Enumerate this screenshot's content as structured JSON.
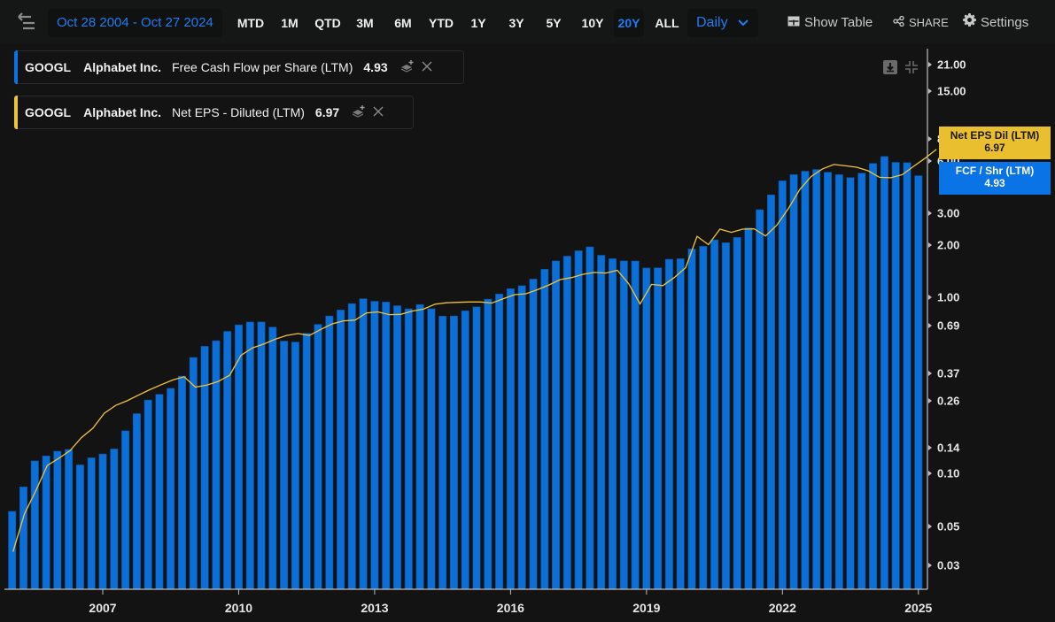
{
  "toolbar": {
    "date_range": "Oct 28 2004 - Oct 27 2024",
    "ranges": [
      "MTD",
      "1M",
      "QTD",
      "3M",
      "6M",
      "YTD",
      "1Y",
      "3Y",
      "5Y",
      "10Y",
      "20Y",
      "ALL"
    ],
    "active_range": "20Y",
    "interval": "Daily",
    "show_table_label": "Show Table",
    "share_label": "SHARE",
    "settings_label": "Settings"
  },
  "legend": [
    {
      "ticker": "GOOGL",
      "company": "Alphabet Inc.",
      "metric": "Free Cash Flow per Share (LTM)",
      "value": "4.93",
      "color": "#0a73e6"
    },
    {
      "ticker": "GOOGL",
      "company": "Alphabet Inc.",
      "metric": "Net EPS - Diluted (LTM)",
      "value": "6.97",
      "color": "#f0c43a"
    }
  ],
  "price_tags": {
    "eps": {
      "label": "Net EPS Dil (LTM)",
      "value": "6.97"
    },
    "fcf": {
      "label": "FCF / Shr (LTM)",
      "value": "4.93"
    }
  },
  "chart_data": {
    "type": "bar+line",
    "yscale": "log",
    "ylim": [
      0.022,
      26
    ],
    "xlim": [
      2004.83,
      2025.2
    ],
    "y_ticks": [
      "21.00",
      "15.00",
      "8.00",
      "6.00",
      "3.00",
      "2.00",
      "1.00",
      "0.69",
      "0.37",
      "0.26",
      "0.14",
      "0.10",
      "0.05",
      "0.03"
    ],
    "y_tick_values": [
      21,
      15,
      8,
      6,
      3,
      2,
      1,
      0.69,
      0.37,
      0.26,
      0.14,
      0.1,
      0.05,
      0.03
    ],
    "x_ticks": [
      "2007",
      "2010",
      "2013",
      "2016",
      "2019",
      "2022",
      "2025"
    ],
    "x_tick_values": [
      2007,
      2010,
      2013,
      2016,
      2019,
      2022,
      2025
    ],
    "x_start": 2005.0,
    "x_step": 0.25,
    "series": [
      {
        "name": "Free Cash Flow per Share (LTM)",
        "kind": "bar",
        "color": "#0a6fd8",
        "values": [
          0.061,
          0.084,
          0.118,
          0.126,
          0.134,
          0.137,
          0.112,
          0.123,
          0.129,
          0.138,
          0.175,
          0.219,
          0.262,
          0.282,
          0.305,
          0.358,
          0.457,
          0.529,
          0.568,
          0.643,
          0.7,
          0.727,
          0.727,
          0.68,
          0.566,
          0.559,
          0.627,
          0.705,
          0.787,
          0.85,
          0.924,
          0.986,
          0.953,
          0.944,
          0.9,
          0.864,
          0.913,
          0.865,
          0.785,
          0.786,
          0.841,
          0.886,
          0.98,
          1.048,
          1.124,
          1.169,
          1.275,
          1.45,
          1.617,
          1.72,
          1.846,
          1.943,
          1.741,
          1.664,
          1.617,
          1.615,
          1.473,
          1.477,
          1.652,
          1.664,
          1.89,
          1.956,
          2.13,
          2.053,
          2.2,
          2.49,
          3.16,
          3.84,
          4.61,
          5.0,
          5.23,
          5.35,
          5.16,
          5.0,
          4.81,
          5.1,
          5.79,
          6.34,
          5.87,
          5.85,
          4.93
        ]
      },
      {
        "name": "Net EPS - Diluted (LTM)",
        "kind": "line",
        "color": "#f0c43a",
        "values": [
          0.036,
          0.059,
          0.08,
          0.111,
          0.122,
          0.135,
          0.16,
          0.181,
          0.22,
          0.244,
          0.259,
          0.279,
          0.3,
          0.32,
          0.34,
          0.355,
          0.31,
          0.318,
          0.334,
          0.362,
          0.47,
          0.518,
          0.545,
          0.58,
          0.61,
          0.625,
          0.61,
          0.66,
          0.71,
          0.738,
          0.745,
          0.818,
          0.83,
          0.8,
          0.803,
          0.838,
          0.86,
          0.917,
          0.935,
          0.94,
          0.945,
          0.945,
          0.932,
          0.986,
          1.04,
          1.052,
          1.11,
          1.18,
          1.266,
          1.3,
          1.357,
          1.39,
          1.38,
          1.43,
          1.2,
          0.92,
          1.19,
          1.17,
          1.3,
          1.48,
          2.23,
          2.0,
          2.45,
          2.35,
          2.45,
          2.46,
          2.24,
          2.58,
          3.2,
          4.11,
          4.88,
          5.39,
          5.71,
          5.61,
          5.51,
          5.26,
          4.83,
          4.8,
          5.0,
          5.58,
          6.2,
          6.97
        ]
      }
    ]
  }
}
